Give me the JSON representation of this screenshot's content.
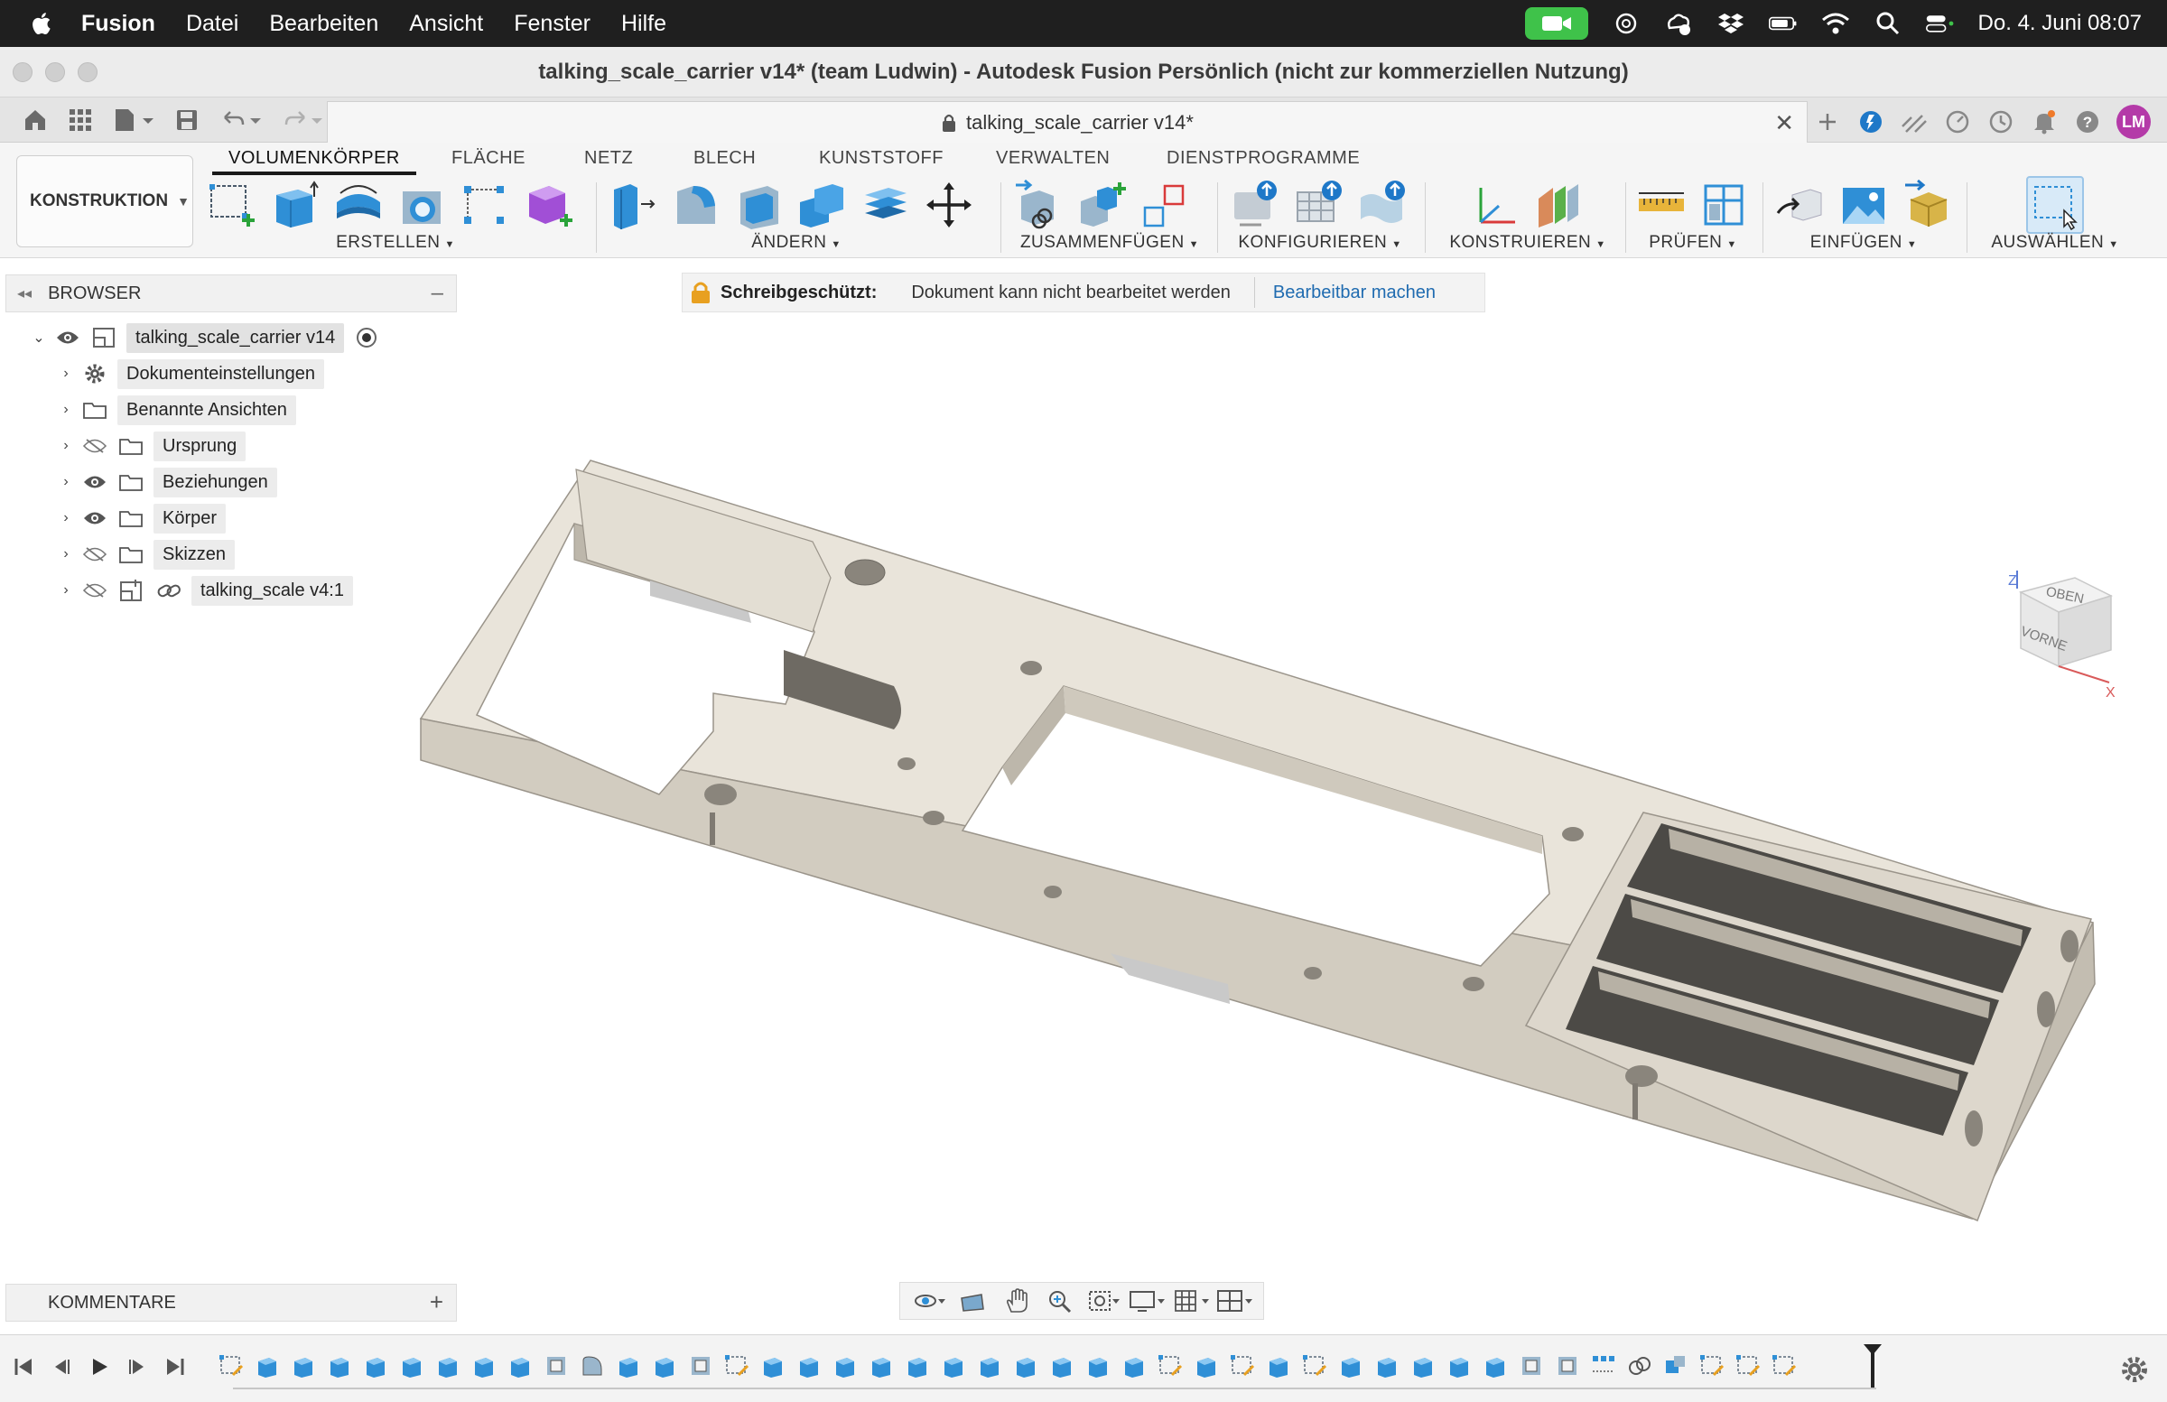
{
  "menubar": {
    "app": "Fusion",
    "items": [
      "Datei",
      "Bearbeiten",
      "Ansicht",
      "Fenster",
      "Hilfe"
    ],
    "datetime": "Do. 4. Juni  08:07"
  },
  "window": {
    "title": "talking_scale_carrier v14* (team Ludwin) - Autodesk Fusion Persönlich (nicht zur kommerziellen Nutzung)"
  },
  "doc_tab": {
    "label": "talking_scale_carrier v14*"
  },
  "user": {
    "initials": "LM",
    "color": "#b43aa8"
  },
  "toolbar": {
    "workspace": "KONSTRUKTION",
    "tabs": [
      "VOLUMENKÖRPER",
      "FLÄCHE",
      "NETZ",
      "BLECH",
      "KUNSTSTOFF",
      "VERWALTEN",
      "DIENSTPROGRAMME"
    ],
    "active_tab": "VOLUMENKÖRPER",
    "groups": [
      "ERSTELLEN",
      "ÄNDERN",
      "ZUSAMMENFÜGEN",
      "KONFIGURIEREN",
      "KONSTRUIEREN",
      "PRÜFEN",
      "EINFÜGEN",
      "AUSWÄHLEN"
    ]
  },
  "browser": {
    "title": "BROWSER",
    "root": "talking_scale_carrier v14",
    "items": [
      {
        "label": "Dokumenteinstellungen",
        "icon": "gear-icon"
      },
      {
        "label": "Benannte Ansichten",
        "icon": "folder-icon"
      },
      {
        "label": "Ursprung",
        "icon": "folder-icon",
        "visible": false
      },
      {
        "label": "Beziehungen",
        "icon": "folder-icon",
        "visible": true
      },
      {
        "label": "Körper",
        "icon": "folder-icon",
        "visible": true
      },
      {
        "label": "Skizzen",
        "icon": "folder-icon",
        "visible": false
      },
      {
        "label": "talking_scale v4:1",
        "icon": "component-link-icon",
        "visible": false
      }
    ]
  },
  "banner": {
    "title": "Schreibgeschützt:",
    "message": "Dokument kann nicht bearbeitet werden",
    "action": "Bearbeitbar machen"
  },
  "viewcube": {
    "top": "OBEN",
    "front": "VORNE",
    "axis_z": "Z",
    "axis_x": "X"
  },
  "comments": {
    "title": "KOMMENTARE"
  },
  "colors": {
    "accent": "#1f6bb0",
    "model_face": "#e8e3d9",
    "model_side": "#cfc9bd",
    "active_tab_underline": "#1a1a1a"
  }
}
